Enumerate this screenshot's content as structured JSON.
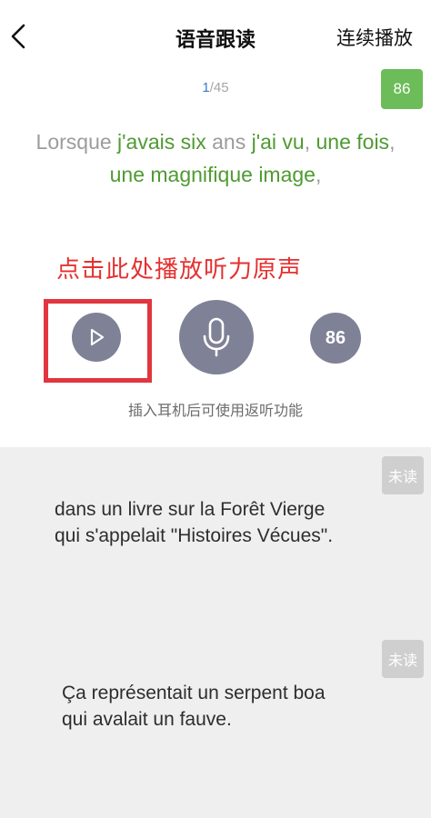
{
  "header": {
    "title": "语音跟读",
    "continuous_label": "连续播放"
  },
  "current": {
    "index": "1",
    "total": "45",
    "score_badge": "86",
    "words": [
      {
        "t": "Lorsque ",
        "c": "gray"
      },
      {
        "t": "j'avais ",
        "c": "green"
      },
      {
        "t": "six ",
        "c": "green"
      },
      {
        "t": "ans ",
        "c": "gray"
      },
      {
        "t": "j'ai ",
        "c": "green"
      },
      {
        "t": "vu",
        "c": "green"
      },
      {
        "t": ", ",
        "c": "gray"
      },
      {
        "t": "une ",
        "c": "green"
      },
      {
        "t": "fois",
        "c": "green"
      },
      {
        "t": ", ",
        "c": "gray"
      },
      {
        "t": "une ",
        "c": "green"
      },
      {
        "t": "magnifique ",
        "c": "green"
      },
      {
        "t": "image",
        "c": "green"
      },
      {
        "t": ",",
        "c": "gray"
      }
    ],
    "hint": "点击此处播放听力原声",
    "score_circle": "86",
    "earphone_note": "插入耳机后可使用返听功能"
  },
  "sentences": [
    {
      "status": "未读",
      "line1": "dans un livre sur la Forêt Vierge",
      "line2": "qui s'appelait \"Histoires Vécues\"."
    },
    {
      "status": "未读",
      "line1": "Ça représentait un serpent boa",
      "line2": "qui avalait un fauve."
    }
  ],
  "colors": {
    "green": "#4f9a32",
    "gray_word": "#9c9c9c",
    "badge_green": "#6cbc59",
    "control_gray": "#7f8197",
    "highlight_red": "#e2353f"
  },
  "icons": [
    "back-chevron-icon",
    "play-icon",
    "microphone-icon"
  ]
}
